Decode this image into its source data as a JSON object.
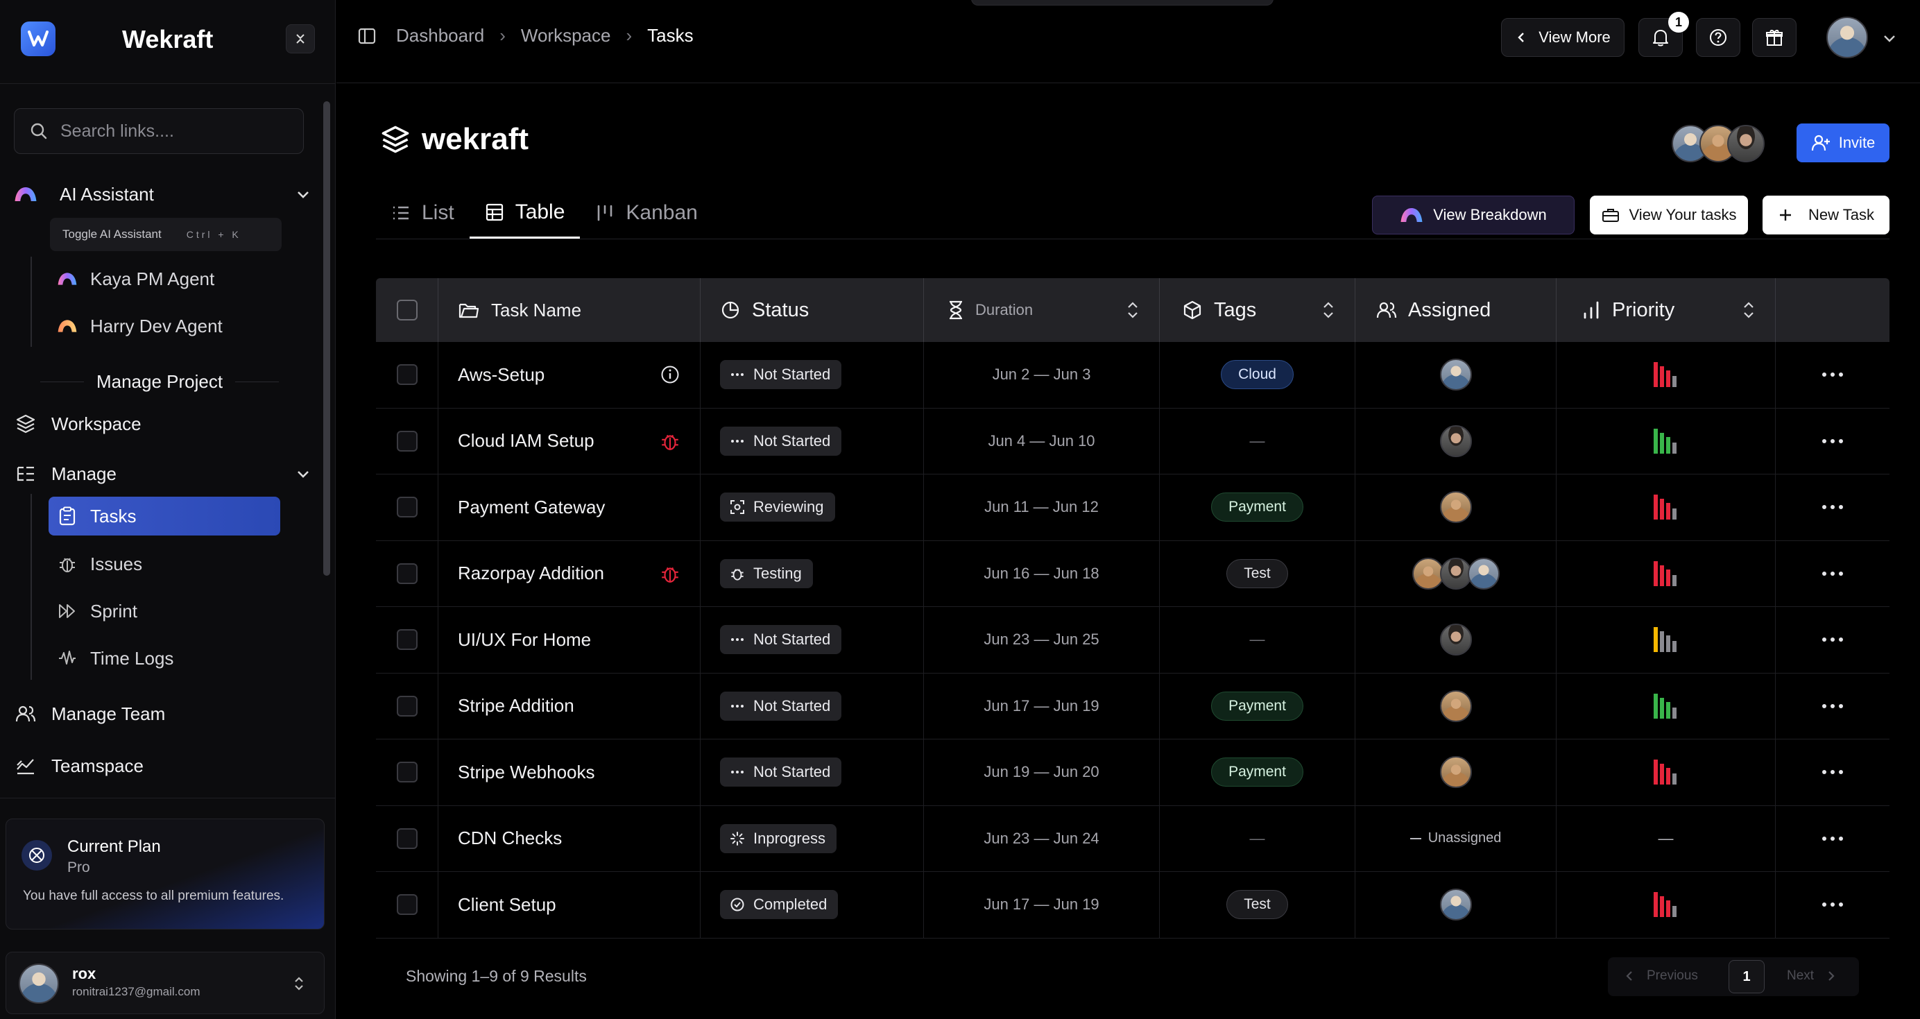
{
  "brand": {
    "name": "Wekraft"
  },
  "sidebar": {
    "search_placeholder": "Search links....",
    "ai_assistant": {
      "label": "AI Assistant",
      "toggle_label": "Toggle AI Assistant",
      "shortcut": "Ctrl + K",
      "agents": [
        "Kaya PM Agent",
        "Harry Dev Agent"
      ]
    },
    "section_title": "Manage Project",
    "workspace": "Workspace",
    "manage": {
      "label": "Manage",
      "items": [
        "Tasks",
        "Issues",
        "Sprint",
        "Time Logs"
      ]
    },
    "manage_team": "Manage Team",
    "teamspace": "Teamspace",
    "plan": {
      "title": "Current Plan",
      "tier": "Pro",
      "description": "You have full access to all premium features."
    },
    "user": {
      "name": "rox",
      "email": "ronitrai1237@gmail.com"
    }
  },
  "topbar": {
    "breadcrumbs": [
      "Dashboard",
      "Workspace",
      "Tasks"
    ],
    "view_more": "View More",
    "notification_count": "1"
  },
  "project": {
    "title": "wekraft",
    "invite_label": "Invite",
    "tabs": [
      "List",
      "Table",
      "Kanban"
    ],
    "active_tab": "Table",
    "actions": {
      "breakdown": "View Breakdown",
      "your_tasks": "View Your tasks",
      "new_task": "New Task"
    }
  },
  "table": {
    "columns": [
      "Task Name",
      "Status",
      "Duration",
      "Tags",
      "Assigned",
      "Priority"
    ],
    "rows": [
      {
        "name": "Aws-Setup",
        "icon": "info-icon",
        "status": "Not Started",
        "status_icon": "dots-icon",
        "duration": "Jun 2 — Jun 3",
        "tag": "Cloud",
        "tag_kind": "cloud",
        "assigned": [
          "a"
        ],
        "priority": "high"
      },
      {
        "name": "Cloud IAM Setup",
        "icon": "bug-icon",
        "status": "Not Started",
        "status_icon": "dots-icon",
        "duration": "Jun 4 — Jun 10",
        "tag": "—",
        "tag_kind": "none",
        "assigned": [
          "b"
        ],
        "priority": "low"
      },
      {
        "name": "Payment Gateway",
        "icon": "",
        "status": "Reviewing",
        "status_icon": "scan-icon",
        "duration": "Jun 11 — Jun 12",
        "tag": "Payment",
        "tag_kind": "payment",
        "assigned": [
          "c"
        ],
        "priority": "high"
      },
      {
        "name": "Razorpay Addition",
        "icon": "bug-icon",
        "status": "Testing",
        "status_icon": "bug-icon",
        "duration": "Jun 16 — Jun 18",
        "tag": "Test",
        "tag_kind": "test",
        "assigned": [
          "c",
          "b",
          "a"
        ],
        "priority": "high"
      },
      {
        "name": "UI/UX For Home",
        "icon": "",
        "status": "Not Started",
        "status_icon": "dots-icon",
        "duration": "Jun 23 — Jun 25",
        "tag": "—",
        "tag_kind": "none",
        "assigned": [
          "b"
        ],
        "priority": "medium"
      },
      {
        "name": "Stripe Addition",
        "icon": "",
        "status": "Not Started",
        "status_icon": "dots-icon",
        "duration": "Jun 17 — Jun 19",
        "tag": "Payment",
        "tag_kind": "payment",
        "assigned": [
          "c"
        ],
        "priority": "low"
      },
      {
        "name": "Stripe Webhooks",
        "icon": "",
        "status": "Not Started",
        "status_icon": "dots-icon",
        "duration": "Jun 19 — Jun 20",
        "tag": "Payment",
        "tag_kind": "payment",
        "assigned": [
          "c"
        ],
        "priority": "high"
      },
      {
        "name": "CDN Checks",
        "icon": "",
        "status": "Inprogress",
        "status_icon": "spinner-icon",
        "duration": "Jun 23 — Jun 24",
        "tag": "—",
        "tag_kind": "none",
        "assigned": [],
        "assigned_label": "Unassigned",
        "priority": "none",
        "priority_label": "—"
      },
      {
        "name": "Client Setup",
        "icon": "",
        "status": "Completed",
        "status_icon": "check-circle-icon",
        "duration": "Jun 17 — Jun 19",
        "tag": "Test",
        "tag_kind": "test",
        "assigned": [
          "a"
        ],
        "priority": "high"
      }
    ]
  },
  "footer": {
    "results": "Showing 1–9 of 9 Results",
    "previous": "Previous",
    "page": "1",
    "next": "Next"
  },
  "colors": {
    "accent": "#2f64f0",
    "priority_high": "#e5253b",
    "priority_low": "#39b54a",
    "priority_medium": "#f5b700",
    "bar_idle": "#8a8a90"
  }
}
